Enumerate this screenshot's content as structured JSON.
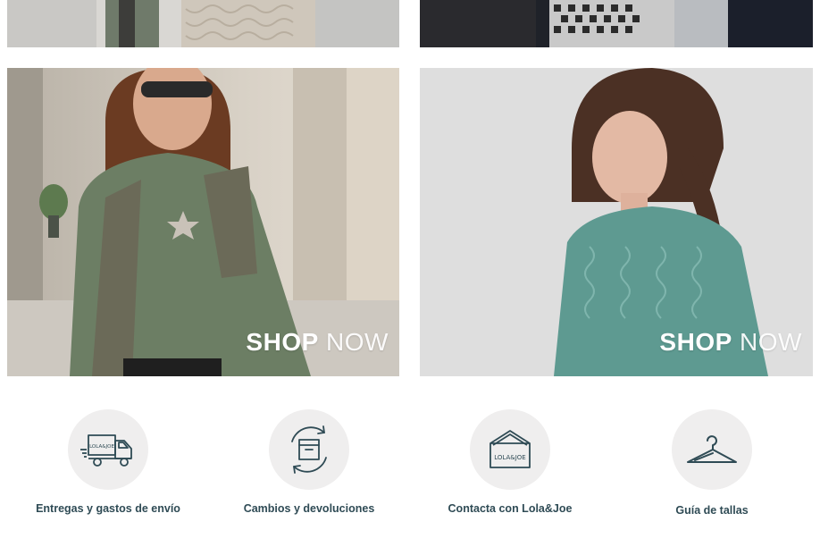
{
  "promo_tiles": [
    {
      "shop_bold": "",
      "shop_thin": ""
    },
    {
      "shop_bold": "",
      "shop_thin": ""
    },
    {
      "shop_bold": "SHOP",
      "shop_thin": " NOW"
    },
    {
      "shop_bold": "SHOP",
      "shop_thin": " NOW"
    }
  ],
  "services": [
    {
      "label": "Entregas y gastos de envío",
      "icon": "delivery-truck-icon",
      "icon_text": "LOLA&JOE"
    },
    {
      "label": "Cambios y devoluciones",
      "icon": "return-box-icon"
    },
    {
      "label": "Contacta con Lola&Joe",
      "icon": "house-contact-icon",
      "icon_text": "LOLA&JOE"
    },
    {
      "label": "Guía de tallas",
      "icon": "hanger-icon"
    }
  ],
  "colors": {
    "text": "#2f4b55",
    "icon_stroke": "#2f4b55",
    "icon_circle_bg": "#efeeee",
    "overlay_text": "#ffffff"
  }
}
